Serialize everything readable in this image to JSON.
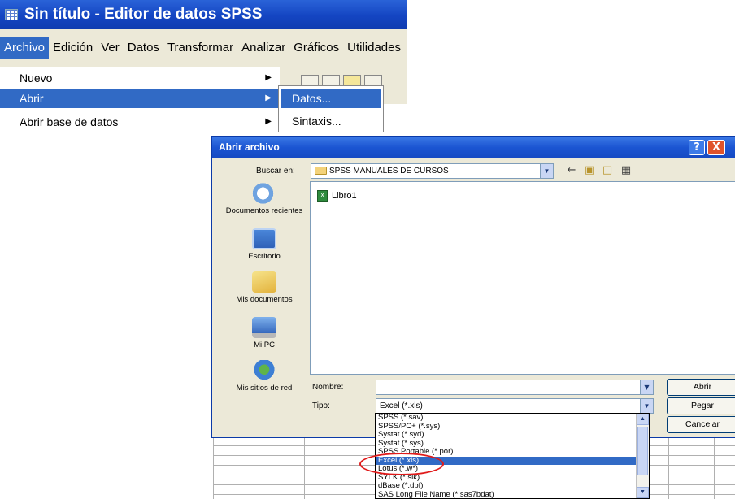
{
  "window": {
    "title": "Sin título - Editor de datos SPSS"
  },
  "menubar": [
    {
      "label": "Archivo",
      "active": true
    },
    {
      "label": "Edición",
      "active": false
    },
    {
      "label": "Ver",
      "active": false
    },
    {
      "label": "Datos",
      "active": false
    },
    {
      "label": "Transformar",
      "active": false
    },
    {
      "label": "Analizar",
      "active": false
    },
    {
      "label": "Gráficos",
      "active": false
    },
    {
      "label": "Utilidades",
      "active": false
    }
  ],
  "archivo_menu": {
    "items": [
      "Nuevo",
      "Abrir",
      "Abrir base de datos"
    ],
    "selected": "Abrir"
  },
  "abrir_submenu": {
    "items": [
      "Datos...",
      "Sintaxis..."
    ],
    "selected": "Datos..."
  },
  "dialog": {
    "title": "Abrir archivo",
    "help_button": "?",
    "close_button": "X",
    "look_in_label": "Buscar en:",
    "look_in_value": "SPSS MANUALES DE CURSOS",
    "places": [
      {
        "label": "Documentos recientes",
        "icon": "recent-documents-icon"
      },
      {
        "label": "Escritorio",
        "icon": "desktop-icon"
      },
      {
        "label": "Mis documentos",
        "icon": "my-documents-icon"
      },
      {
        "label": "Mi PC",
        "icon": "my-computer-icon"
      },
      {
        "label": "Mis sitios de red",
        "icon": "network-places-icon"
      }
    ],
    "files": [
      {
        "name": "Libro1",
        "icon": "excel-file-icon"
      }
    ],
    "name_label": "Nombre:",
    "name_value": "",
    "type_label": "Tipo:",
    "type_value": "Excel (*.xls)",
    "buttons": {
      "open": "Abrir",
      "paste": "Pegar",
      "cancel": "Cancelar"
    },
    "type_options": [
      "SPSS (*.sav)",
      "SPSS/PC+ (*.sys)",
      "Systat (*.syd)",
      "Systat (*.sys)",
      "SPSS Portable (*.por)",
      "Excel (*.xls)",
      "Lotus (*.w*)",
      "SYLK (*.slk)",
      "dBase (*.dbf)",
      "SAS Long File Name (*.sas7bdat)"
    ],
    "type_selected": "Excel (*.xls)"
  },
  "colors": {
    "xp_title_blue": "#1445c2",
    "selection_blue": "#316ac5",
    "dialog_face": "#ece9d8",
    "highlight_red": "#e01a1a"
  }
}
